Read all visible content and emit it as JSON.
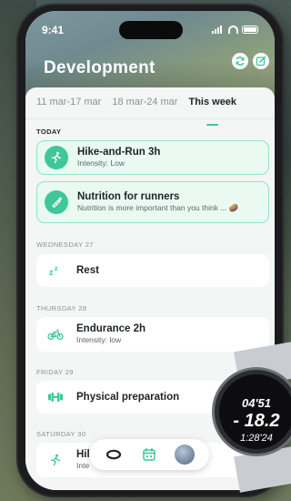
{
  "status_bar": {
    "time": "9:41"
  },
  "header": {
    "title": "Development"
  },
  "tabs": [
    {
      "label": "11 mar-17 mar",
      "active": false
    },
    {
      "label": "18 mar-24 mar",
      "active": false
    },
    {
      "label": "This week",
      "active": true
    }
  ],
  "sections": {
    "today": "TODAY",
    "wednesday": "WEDNESDAY 27",
    "thursday": "THURSDAY 28",
    "friday": "FRIDAY 29",
    "saturday": "SATURDAY 30"
  },
  "cards": {
    "hike": {
      "title": "Hike-and-Run 3h",
      "subtitle": "Intensity: Low",
      "icon": "running-icon"
    },
    "nutrition": {
      "title": "Nutrition for runners",
      "subtitle": "Nutrition is more important than you think ... 🥔",
      "icon": "carrot-icon"
    },
    "rest": {
      "title": "Rest",
      "icon": "sleep-icon"
    },
    "endurance": {
      "title": "Endurance 2h",
      "subtitle": "Intensity: low",
      "icon": "bike-icon"
    },
    "physical": {
      "title": "Physical preparation",
      "icon": "dumbbell-icon"
    },
    "hill": {
      "title": "Hill",
      "subtitle": "Inte",
      "icon": "running-icon"
    }
  },
  "watch": {
    "line1": "04'51",
    "line2": "- 18.2",
    "line3": "1:28'24"
  },
  "colors": {
    "accent": "#3fc79a",
    "card_highlight_bg": "#eafaf3",
    "card_highlight_border": "#8fe3c3"
  }
}
